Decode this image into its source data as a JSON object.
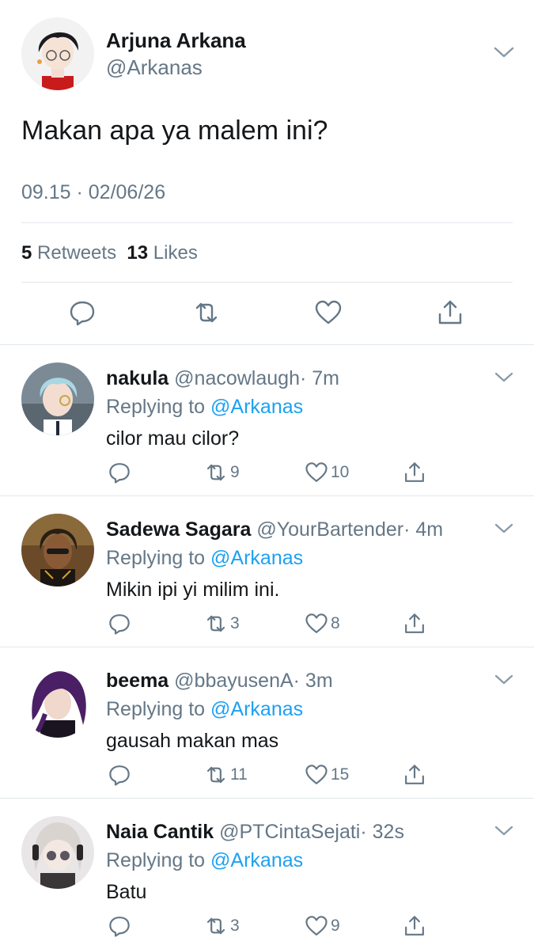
{
  "tweet": {
    "author_name": "Arjuna Arkana",
    "author_handle": "@Arkanas",
    "text": "Makan apa ya malem ini?",
    "timestamp": "09.15 · 02/06/26",
    "retweets_count": "5",
    "retweets_label": "Retweets",
    "likes_count": "13",
    "likes_label": "Likes"
  },
  "replies": [
    {
      "name": "nakula",
      "handle": "@nacowlaugh",
      "time": "· 7m",
      "replying_label": "Replying to",
      "replying_to": "@Arkanas",
      "text": "cilor mau cilor?",
      "retweets": "9",
      "likes": "10",
      "avatar_colors": {
        "bg": "#7c8a95",
        "hair": "#a9d7e4",
        "skin": "#f3ddd0",
        "cloth": "#ffffff"
      }
    },
    {
      "name": "Sadewa Sagara",
      "handle": "@YourBartender",
      "time": "· 4m",
      "replying_label": "Replying to",
      "replying_to": "@Arkanas",
      "text": "Mikin ipi yi milim ini.",
      "retweets": "3",
      "likes": "8",
      "avatar_colors": {
        "bg": "#6b4a2a",
        "hair": "#2a1e14",
        "skin": "#8a5a36",
        "cloth": "#1b1612"
      }
    },
    {
      "name": "beema",
      "handle": "@bbayusenA",
      "time": "· 3m",
      "replying_label": "Replying to",
      "replying_to": "@Arkanas",
      "text": "gausah makan mas",
      "retweets": "11",
      "likes": "15",
      "avatar_colors": {
        "bg": "#ffffff",
        "hair": "#4b1f66",
        "skin": "#f0d8cc",
        "cloth": "#1a1420"
      }
    },
    {
      "name": "Naia Cantik",
      "handle": "@PTCintaSejati",
      "time": "· 32s",
      "replying_label": "Replying to",
      "replying_to": "@Arkanas",
      "text": "Batu",
      "retweets": "3",
      "likes": "9",
      "avatar_colors": {
        "bg": "#e8e6e6",
        "hair": "#d9d4cf",
        "skin": "#f4e8e2",
        "cloth": "#3a3536"
      }
    }
  ],
  "icons": {
    "reply": "reply-icon",
    "retweet": "retweet-icon",
    "like": "like-icon",
    "share": "share-icon",
    "more": "chevron-down-icon"
  },
  "colors": {
    "text": "#14171a",
    "secondary": "#657786",
    "mention": "#1da1f2",
    "divider": "#e1e8ed"
  }
}
